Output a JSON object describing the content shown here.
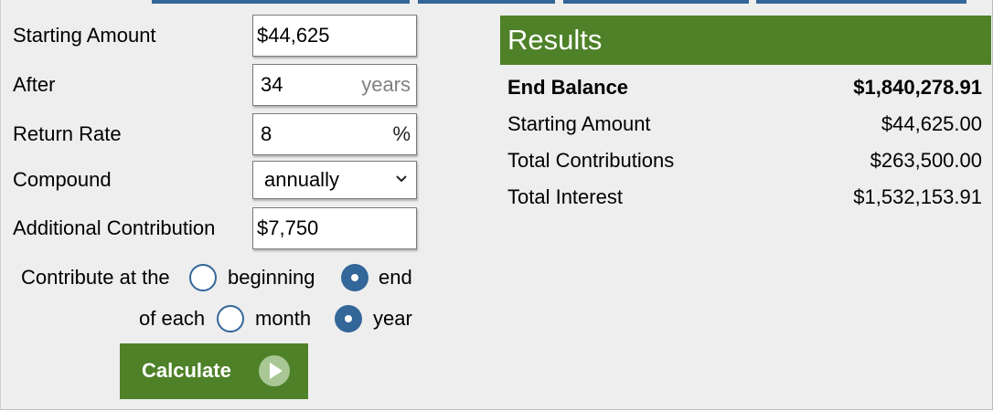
{
  "form": {
    "starting_amount": {
      "label": "Starting Amount",
      "value": "$44,625"
    },
    "after": {
      "label": "After",
      "value": "34",
      "unit": "years"
    },
    "return_rate": {
      "label": "Return Rate",
      "value": "8",
      "unit": "%"
    },
    "compound": {
      "label": "Compound",
      "selected": "annually"
    },
    "additional_contribution": {
      "label": "Additional Contribution",
      "value": "$7,750"
    },
    "contribute_at": {
      "prefix": "Contribute at the",
      "options": [
        {
          "label": "beginning",
          "selected": false
        },
        {
          "label": "end",
          "selected": true
        }
      ]
    },
    "of_each": {
      "prefix": "of each",
      "options": [
        {
          "label": "month",
          "selected": false
        },
        {
          "label": "year",
          "selected": true
        }
      ]
    },
    "calculate_label": "Calculate"
  },
  "results": {
    "title": "Results",
    "rows": [
      {
        "label": "End Balance",
        "value": "$1,840,278.91",
        "bold": true
      },
      {
        "label": "Starting Amount",
        "value": "$44,625.00",
        "bold": false
      },
      {
        "label": "Total Contributions",
        "value": "$263,500.00",
        "bold": false
      },
      {
        "label": "Total Interest",
        "value": "$1,532,153.91",
        "bold": false
      }
    ]
  },
  "colors": {
    "accent_green": "#4e8128",
    "radio_blue": "#336699",
    "tab_blue": "#336699",
    "panel_bg": "#eeeeee"
  },
  "icons": {
    "select": "chevron-down-icon",
    "calculate": "play-arrow-icon"
  }
}
